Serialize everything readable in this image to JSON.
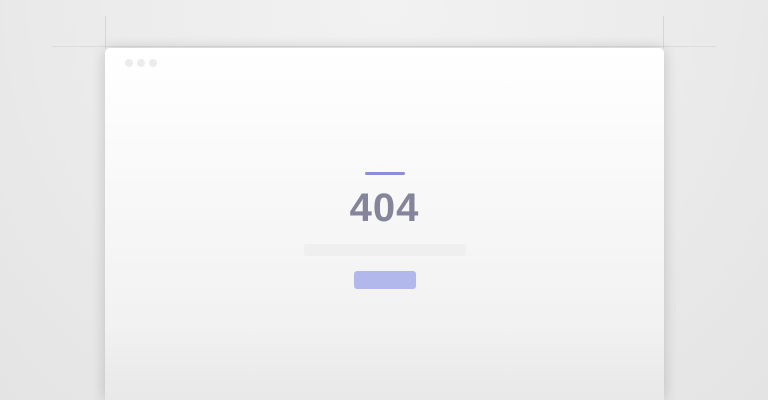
{
  "error": {
    "code": "404",
    "message": "",
    "button_label": ""
  },
  "window": {
    "traffic_lights": [
      "close-dot",
      "minimize-dot",
      "maximize-dot"
    ]
  },
  "colors": {
    "accent": "#8a8ed8",
    "button": "#b2b8ec",
    "code_text": "#84849a",
    "background": "#ebebeb"
  }
}
